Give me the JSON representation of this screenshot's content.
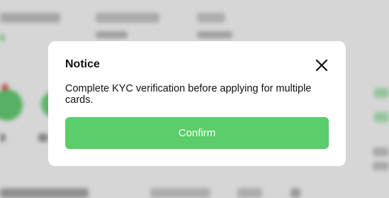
{
  "dialog": {
    "title": "Notice",
    "message": "Complete KYC verification before applying for multiple cards.",
    "confirm_label": "Confirm",
    "close_icon": "close-icon"
  },
  "colors": {
    "accent": "#5bcd6a",
    "background": "#f4f4f4",
    "dialog_bg": "#ffffff",
    "text": "#111111"
  }
}
